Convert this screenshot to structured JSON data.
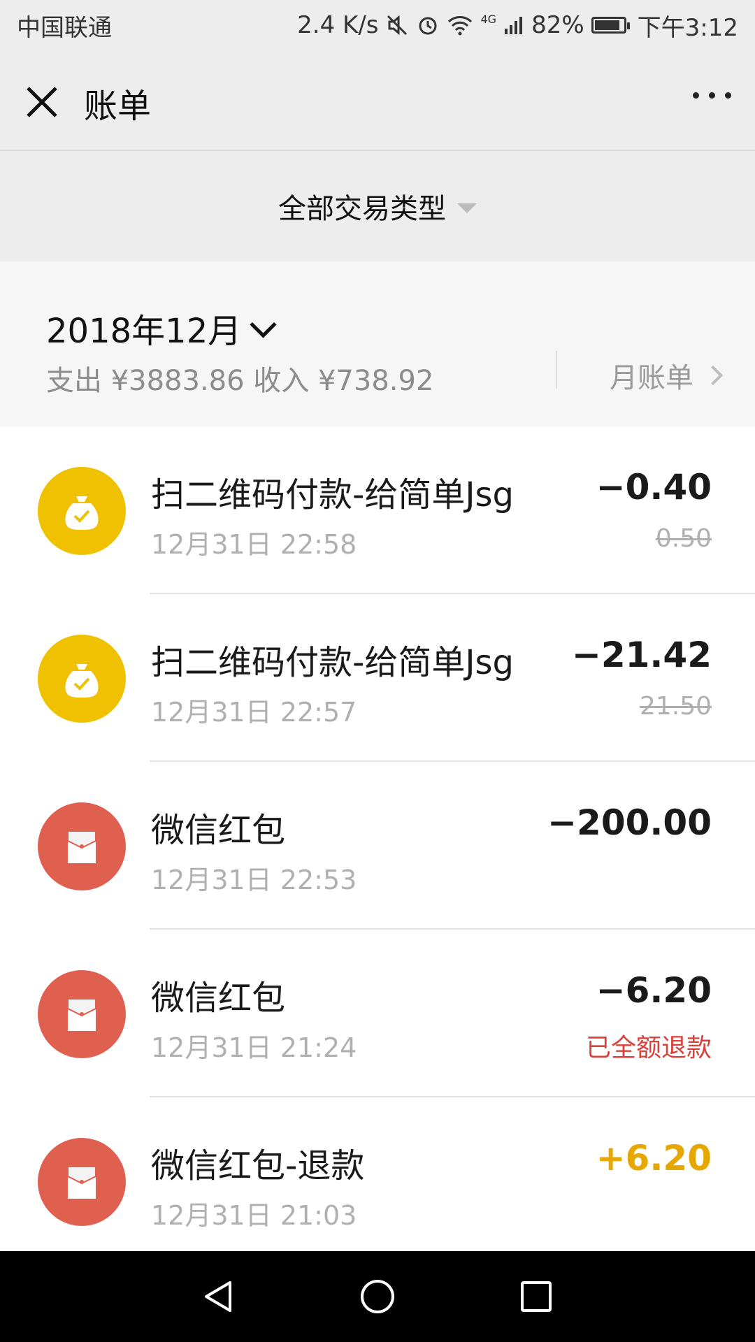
{
  "status_bar": {
    "carrier": "中国联通",
    "speed": "2.4 K/s",
    "network": "4G",
    "battery": "82%",
    "time": "下午3:12"
  },
  "header": {
    "title": "账单"
  },
  "filter": {
    "label": "全部交易类型"
  },
  "month": {
    "title": "2018年12月",
    "summary": "支出 ¥3883.86 收入 ¥738.92",
    "bill_link": "月账单"
  },
  "transactions": [
    {
      "title": "扫二维码付款-给简单Jsg",
      "time": "12月31日 22:58",
      "amount": "−0.40",
      "sub": "0.50",
      "icon": "money-bag-icon"
    },
    {
      "title": "扫二维码付款-给简单Jsg",
      "time": "12月31日 22:57",
      "amount": "−21.42",
      "sub": "21.50",
      "icon": "money-bag-icon"
    },
    {
      "title": "微信红包",
      "time": "12月31日 22:53",
      "amount": "−200.00",
      "sub": "",
      "icon": "red-packet-icon"
    },
    {
      "title": "微信红包",
      "time": "12月31日 21:24",
      "amount": "−6.20",
      "sub": "已全额退款",
      "icon": "red-packet-icon"
    },
    {
      "title": "微信红包-退款",
      "time": "12月31日 21:03",
      "amount": "+6.20",
      "sub": "",
      "icon": "red-packet-icon"
    }
  ],
  "colors": {
    "yellow_icon": "#f0c100",
    "red_icon": "#e06050",
    "income": "#e6a700",
    "refund_text": "#d9413a"
  }
}
